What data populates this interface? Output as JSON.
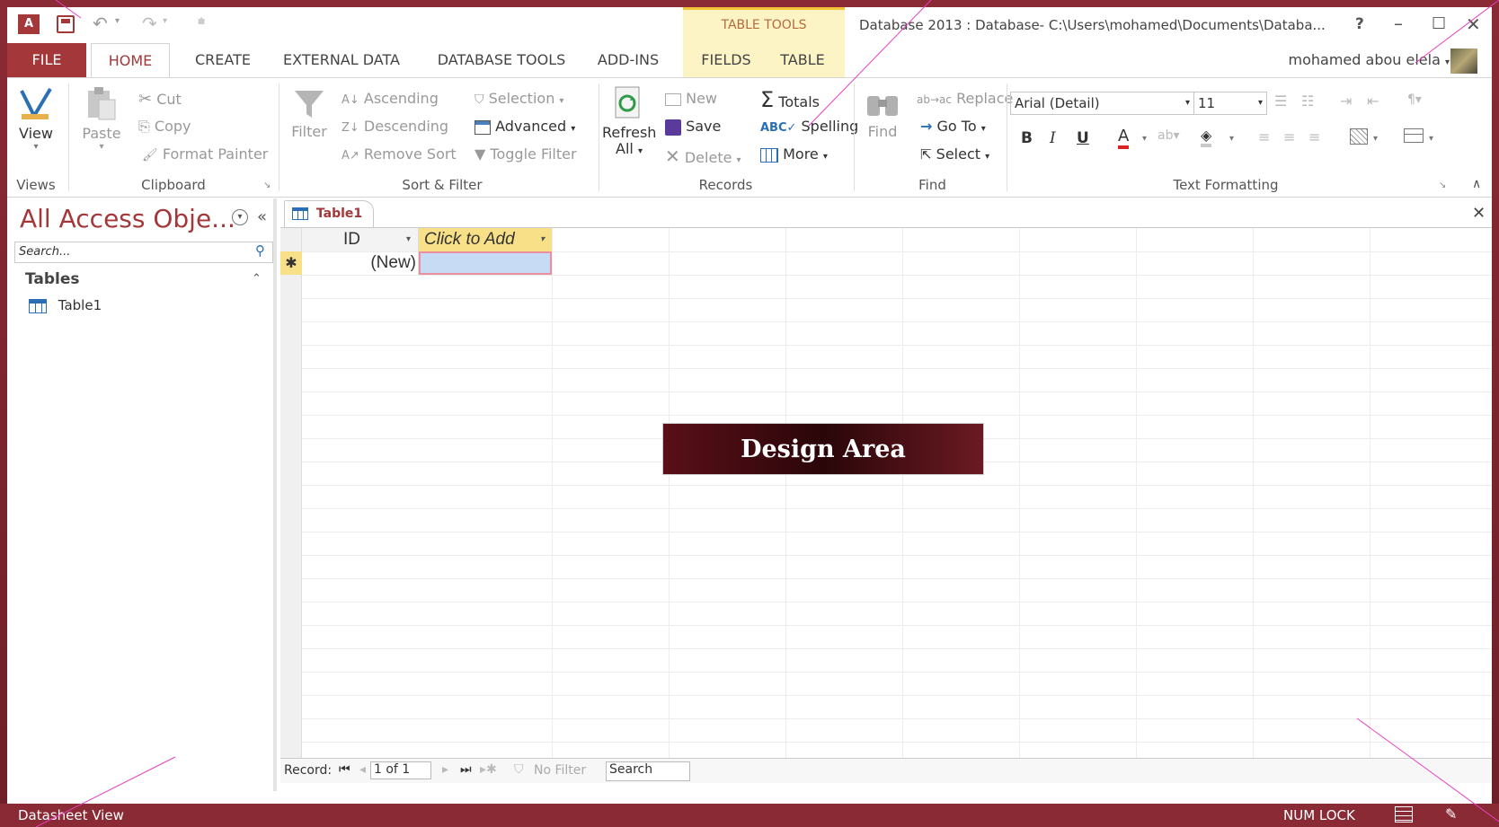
{
  "titlebar": {
    "context_tab": "TABLE TOOLS",
    "title": "Database 2013 : Database- C:\\Users\\mohamed\\Documents\\Databa...",
    "help": "?",
    "minimize": "–",
    "maximize": "☐",
    "close": "✕"
  },
  "tabs": {
    "file": "FILE",
    "home": "HOME",
    "create": "CREATE",
    "external": "EXTERNAL DATA",
    "dbtools": "DATABASE TOOLS",
    "addins": "ADD-INS",
    "fields": "FIELDS",
    "table": "TABLE",
    "user": "mohamed abou elela"
  },
  "ribbon": {
    "views": {
      "view": "View",
      "label": "Views"
    },
    "clipboard": {
      "paste": "Paste",
      "cut": "Cut",
      "copy": "Copy",
      "format_painter": "Format Painter",
      "label": "Clipboard"
    },
    "sort": {
      "filter": "Filter",
      "ascending": "Ascending",
      "descending": "Descending",
      "remove_sort": "Remove Sort",
      "selection": "Selection",
      "advanced": "Advanced",
      "toggle_filter": "Toggle Filter",
      "label": "Sort & Filter"
    },
    "records": {
      "refresh": "Refresh",
      "all": "All",
      "new": "New",
      "save": "Save",
      "delete": "Delete",
      "totals": "Totals",
      "spelling": "Spelling",
      "more": "More",
      "label": "Records"
    },
    "find": {
      "find": "Find",
      "replace": "Replace",
      "goto": "Go To",
      "select": "Select",
      "label": "Find"
    },
    "text": {
      "font": "Arial (Detail)",
      "size": "11",
      "bold": "B",
      "italic": "I",
      "underline": "U",
      "label": "Text Formatting"
    }
  },
  "nav": {
    "title": "All Access Obje...",
    "search_placeholder": "Search...",
    "section": "Tables",
    "item": "Table1"
  },
  "doc": {
    "tab": "Table1",
    "col_id": "ID",
    "col_add": "Click to Add",
    "new_row": "(New)",
    "new_marker": "✱",
    "overlay": "Design Area"
  },
  "recordnav": {
    "label": "Record:",
    "position": "1 of 1",
    "no_filter": "No Filter",
    "search": "Search"
  },
  "status": {
    "view": "Datasheet View",
    "numlock": "NUM LOCK"
  },
  "colors": {
    "accent": "#a4373a",
    "frame": "#7d2630",
    "context": "#fdf4c6",
    "header_yellow": "#f8e088"
  }
}
